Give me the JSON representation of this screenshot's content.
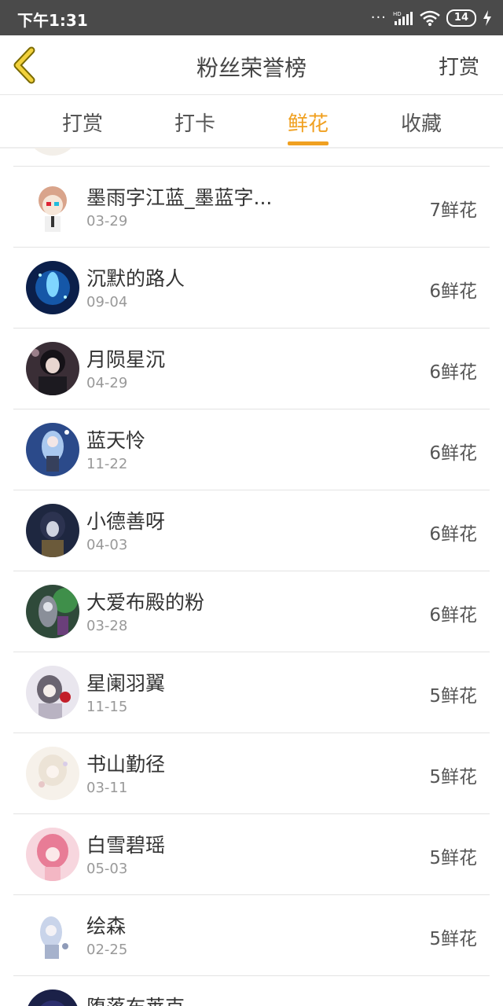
{
  "status_bar": {
    "time": "下午1:31",
    "battery": "14"
  },
  "header": {
    "title": "粉丝荣誉榜",
    "action": "打赏"
  },
  "tabs": [
    {
      "label": "打赏",
      "active": false
    },
    {
      "label": "打卡",
      "active": false
    },
    {
      "label": "鲜花",
      "active": true
    },
    {
      "label": "收藏",
      "active": false
    }
  ],
  "colors": {
    "accent": "#f0a020",
    "status_bar": "#4a4a4a"
  },
  "list": [
    {
      "name": "墨雨字江蓝_墨蓝字...",
      "date": "03-29",
      "count": "7鲜花"
    },
    {
      "name": "沉默的路人",
      "date": "09-04",
      "count": "6鲜花"
    },
    {
      "name": "月陨星沉",
      "date": "04-29",
      "count": "6鲜花"
    },
    {
      "name": "蓝天怜",
      "date": "11-22",
      "count": "6鲜花"
    },
    {
      "name": "小德善呀",
      "date": "04-03",
      "count": "6鲜花"
    },
    {
      "name": "大爱布殿的粉",
      "date": "03-28",
      "count": "6鲜花"
    },
    {
      "name": "星阑羽翼",
      "date": "11-15",
      "count": "5鲜花"
    },
    {
      "name": "书山勤径",
      "date": "03-11",
      "count": "5鲜花"
    },
    {
      "name": "白雪碧瑶",
      "date": "05-03",
      "count": "5鲜花"
    },
    {
      "name": "绘森",
      "date": "02-25",
      "count": "5鲜花"
    },
    {
      "name": "堕落布莱克",
      "date": "",
      "count": ""
    }
  ]
}
